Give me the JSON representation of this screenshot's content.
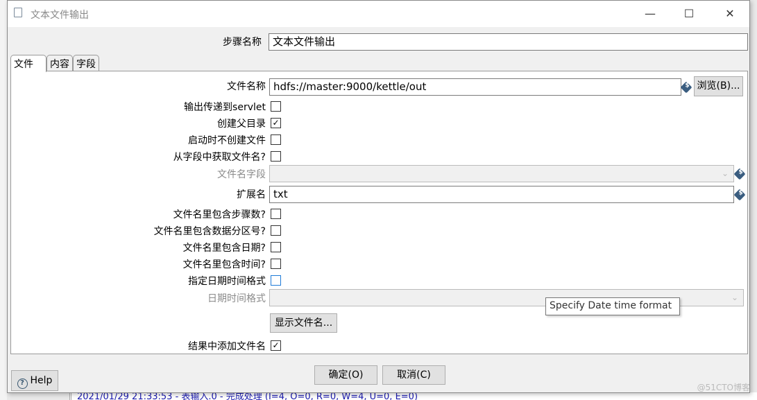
{
  "window": {
    "title": "文本文件输出",
    "minimize_icon": "minimize-icon",
    "maximize_icon": "maximize-icon",
    "close_icon": "close-icon"
  },
  "step_name": {
    "label": "步骤名称",
    "value": "文本文件输出"
  },
  "tabs": [
    {
      "label": "文件",
      "active": true
    },
    {
      "label": "内容"
    },
    {
      "label": "字段"
    }
  ],
  "file_tab": {
    "filename": {
      "label": "文件名称",
      "value": "hdfs://master:9000/kettle/out",
      "browse": "浏览(B)..."
    },
    "pass_to_servlet": {
      "label": "输出传递到servlet",
      "checked": false
    },
    "create_parent": {
      "label": "创建父目录",
      "checked": true
    },
    "no_create_at_start": {
      "label": "启动时不创建文件",
      "checked": false
    },
    "filename_from_field": {
      "label": "从字段中获取文件名?",
      "checked": false
    },
    "filename_field": {
      "label": "文件名字段",
      "value": ""
    },
    "extension": {
      "label": "扩展名",
      "value": "txt"
    },
    "include_stepnr": {
      "label": "文件名里包含步骤数?",
      "checked": false
    },
    "include_partition": {
      "label": "文件名里包含数据分区号?",
      "checked": false
    },
    "include_date": {
      "label": "文件名里包含日期?",
      "checked": false
    },
    "include_time": {
      "label": "文件名里包含时间?",
      "checked": false
    },
    "specify_format": {
      "label": "指定日期时间格式",
      "checked": false
    },
    "date_format": {
      "label": "日期时间格式",
      "value": ""
    },
    "show_filenames": "显示文件名...",
    "add_to_result": {
      "label": "结果中添加文件名",
      "checked": true
    }
  },
  "tooltip": "Specify Date time format",
  "buttons": {
    "ok": "确定(O)",
    "cancel": "取消(C)",
    "help": "Help"
  },
  "background_log": "2021/01/29 21:33:53 - 表输入.0 - 完成处理 (I=4, O=0, R=0, W=4, U=0, E=0)",
  "watermark": "@51CTO博客"
}
